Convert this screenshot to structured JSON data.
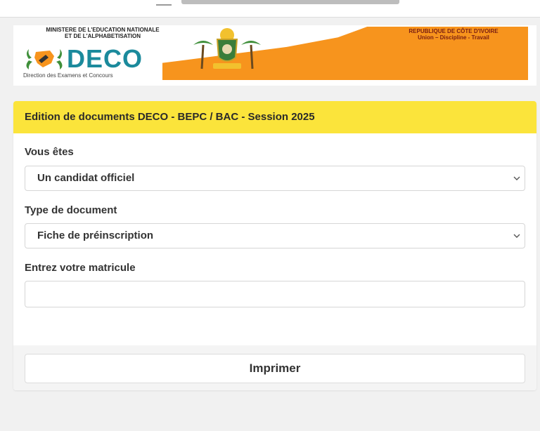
{
  "banner": {
    "ministry_line1": "MINISTERE DE L'EDUCATION NATIONALE",
    "ministry_line2": "ET DE L'ALPHABETISATION",
    "logo_word": "DECO",
    "logo_subtitle": "Direction des Examens et Concours",
    "republic_line1": "REPUBLIQUE DE CÔTE D'IVOIRE",
    "republic_line2": "Union – Discipline - Travail",
    "accent_color": "#f7941d",
    "logo_color": "#1b8a9c"
  },
  "card": {
    "title": "Edition de documents DECO - BEPC / BAC - Session 2025",
    "header_color": "#fbe43b"
  },
  "form": {
    "role_label": "Vous êtes",
    "role_value": "Un candidat officiel",
    "doc_label": "Type de document",
    "doc_value": "Fiche de préinscription",
    "matricule_label": "Entrez votre matricule",
    "matricule_value": ""
  },
  "actions": {
    "print_label": "Imprimer"
  }
}
